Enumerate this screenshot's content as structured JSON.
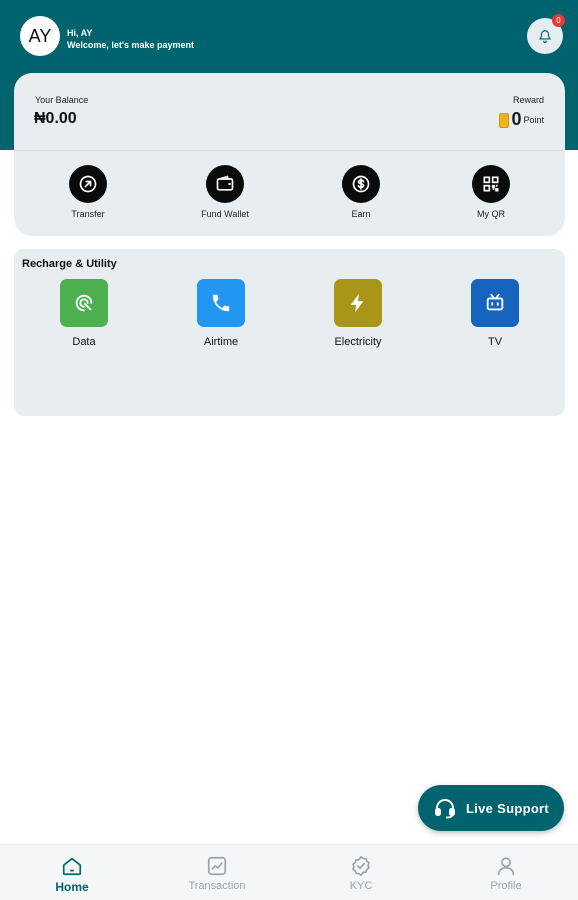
{
  "header": {
    "avatar_initials": "AY",
    "greeting": "Hi, AY",
    "welcome": "Welcome, let's make payment",
    "notification_count": "0"
  },
  "balance": {
    "label": "Your Balance",
    "amount": "₦0.00",
    "reward_label": "Reward",
    "reward_value": "0",
    "reward_unit": "Point"
  },
  "quick_actions": [
    {
      "label": "Transfer",
      "icon": "arrow-up-right-icon"
    },
    {
      "label": "Fund Wallet",
      "icon": "wallet-icon"
    },
    {
      "label": "Earn",
      "icon": "dollar-icon"
    },
    {
      "label": "My QR",
      "icon": "qr-code-icon"
    }
  ],
  "utilities": {
    "title": "Recharge & Utility",
    "items": [
      {
        "label": "Data",
        "icon": "data-icon",
        "color": "#4caf50"
      },
      {
        "label": "Airtime",
        "icon": "phone-icon",
        "color": "#2196f3"
      },
      {
        "label": "Electricity",
        "icon": "bolt-icon",
        "color": "#a99517"
      },
      {
        "label": "TV",
        "icon": "tv-icon",
        "color": "#1565c0"
      }
    ]
  },
  "support": {
    "label": "Live Support"
  },
  "nav": [
    {
      "label": "Home",
      "icon": "home-icon",
      "active": true
    },
    {
      "label": "Transaction",
      "icon": "chart-icon",
      "active": false
    },
    {
      "label": "KYC",
      "icon": "verified-icon",
      "active": false
    },
    {
      "label": "Profile",
      "icon": "person-icon",
      "active": false
    }
  ],
  "colors": {
    "primary": "#00636e",
    "card": "#e8edf0"
  }
}
